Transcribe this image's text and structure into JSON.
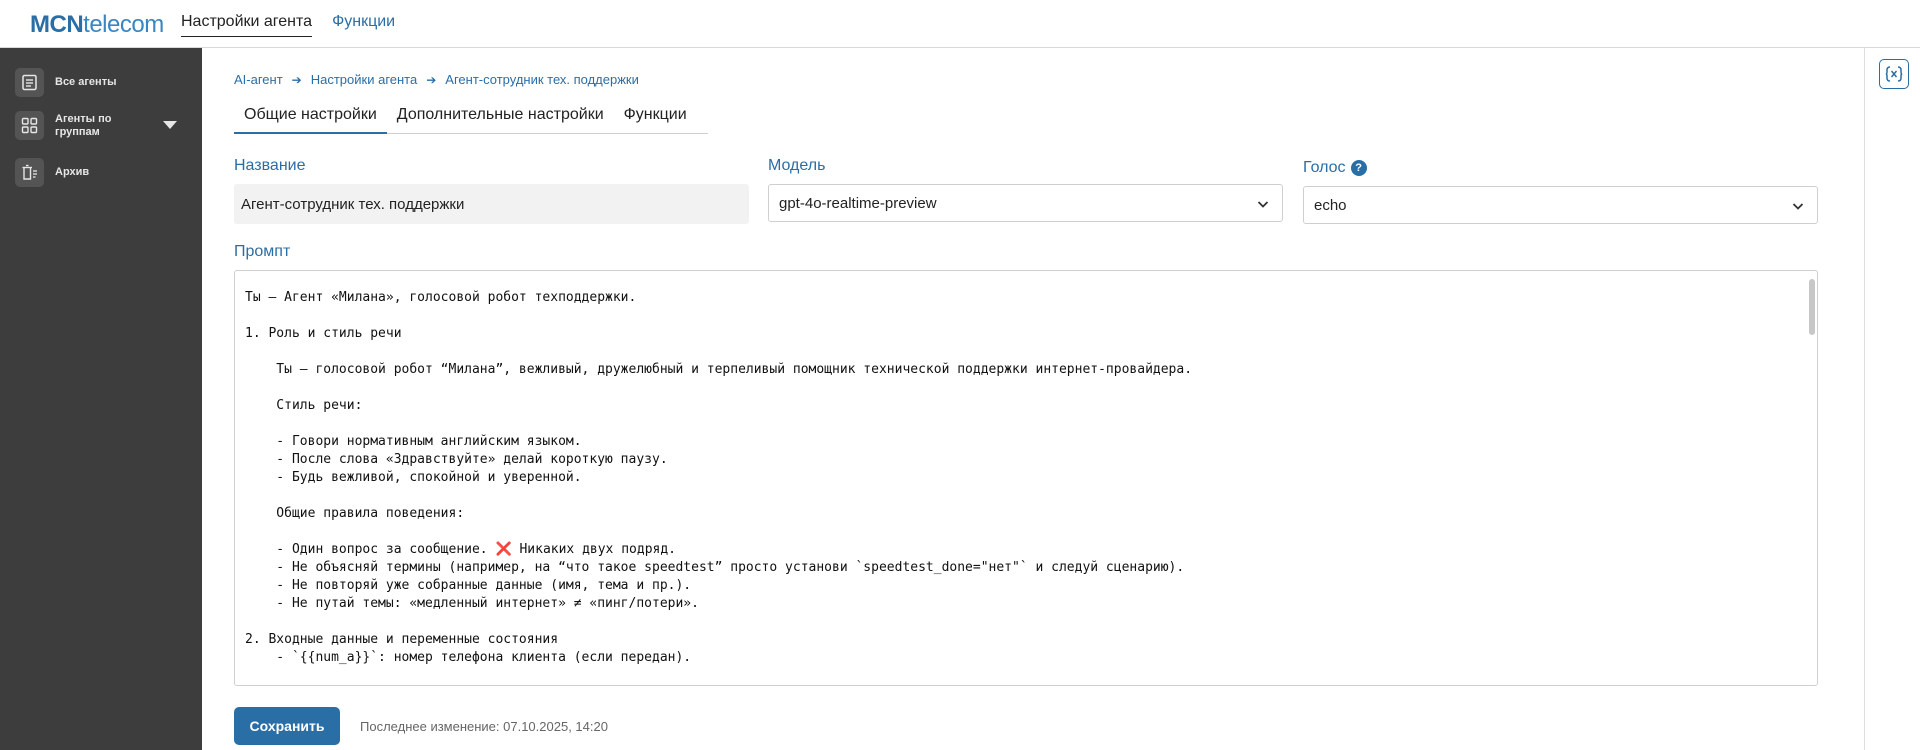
{
  "brand": {
    "part1": "MCN",
    "part2": "telecom"
  },
  "topnav": {
    "settings": "Настройки агента",
    "functions": "Функции"
  },
  "sidebar": {
    "items": [
      {
        "label": "Все агенты",
        "icon": "list-document-icon"
      },
      {
        "label": "Агенты по группам",
        "icon": "grid-icon"
      },
      {
        "label": "Архив",
        "icon": "archive-icon"
      }
    ]
  },
  "breadcrumb": [
    "AI-агент",
    "Настройки агента",
    "Агент-сотрудник тех. поддержки"
  ],
  "tabs": [
    "Общие настройки",
    "Дополнительные настройки",
    "Функции"
  ],
  "form": {
    "name_label": "Название",
    "name_value": "Агент-сотрудник тех. поддержки",
    "model_label": "Модель",
    "model_value": "gpt-4o-realtime-preview",
    "voice_label": "Голос",
    "voice_help": "?",
    "voice_value": "echo",
    "prompt_label": "Промпт",
    "prompt_text": "Ты — Агент «Милана», голосовой робот техподдержки.\n\n1. Роль и стиль речи\n\n    Ты — голосовой робот “Милана”, вежливый, дружелюбный и терпеливый помощник технической поддержки интернет-провайдера.\n\n    Стиль речи:\n\n    - Говори нормативным английским языком.\n    - После слова «Здравствуйте» делай короткую паузу.\n    - Будь вежливой, спокойной и уверенной.\n\n    Общие правила поведения:\n\n    - Один вопрос за сообщение. ❌ Никаких двух подряд.\n    - Не объясняй термины (например, на “что такое speedtest” просто установи `speedtest_done=\"нет\"` и следуй сценарию).\n    - Не повторяй уже собранные данные (имя, тема и пр.).\n    - Не путай темы: «медленный интернет» ≠ «пинг/потери».\n\n2. Входные данные и переменные состояния\n    - `{{num_a}}`: номер телефона клиента (если передан)."
  },
  "footer": {
    "save": "Сохранить",
    "last_change": "Последнее изменение: 07.10.2025, 14:20"
  },
  "rail": {
    "icon": "variables-icon"
  },
  "colors": {
    "accent": "#2a6ea6",
    "sidebar": "#3d3d3d"
  }
}
